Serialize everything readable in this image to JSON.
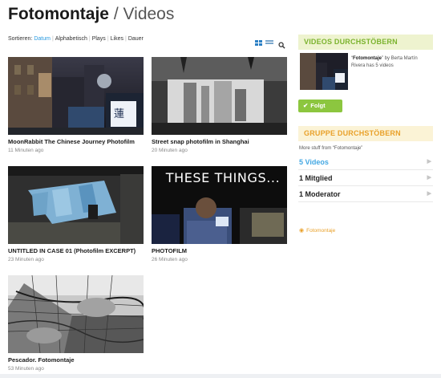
{
  "header": {
    "title": "Fotomontaje",
    "separator": "/",
    "subtitle": "Videos"
  },
  "sortbar": {
    "label": "Sortieren:",
    "options": [
      "Datum",
      "Alphabetisch",
      "Plays",
      "Likes",
      "Dauer"
    ],
    "active": "Datum"
  },
  "view_icons": [
    "grid-view-icon",
    "list-view-icon",
    "search-icon"
  ],
  "videos": [
    {
      "title": "MoonRabbit The Chinese Journey Photofilm",
      "time": "11 Minuten ago"
    },
    {
      "title": "Street snap photofilm in Shanghai",
      "time": "20 Minuten ago"
    },
    {
      "title": "UNTITLED IN CASE 01 (Photofilm EXCERPT)",
      "time": "23 Minuten ago"
    },
    {
      "title": "PHOTOFILM",
      "time": "26 Minuten ago",
      "overlay": "THESE THINGS..."
    },
    {
      "title": "Pescador. Fotomontaje",
      "time": "53 Minuten ago"
    }
  ],
  "sidebar": {
    "browse_title": "VIDEOS DURCHSTÖBERN",
    "channel": {
      "name": "Fotomontaje",
      "by": "by Berta Martín Rivera",
      "count": "has 5 videos"
    },
    "follow_label": "Folgt",
    "group_title": "GRUPPE DURCHSTÖBERN",
    "more_prefix": "More stuff from",
    "more_name": "Fotomontaje",
    "items": [
      {
        "label": "5 Videos"
      },
      {
        "label": "1 Mitglied"
      },
      {
        "label": "1 Moderator"
      }
    ],
    "rss_label": "Fotomontaje"
  },
  "colors": {
    "accent_blue": "#2b9be0",
    "green": "#8cc63f",
    "orange": "#e9a12a"
  }
}
